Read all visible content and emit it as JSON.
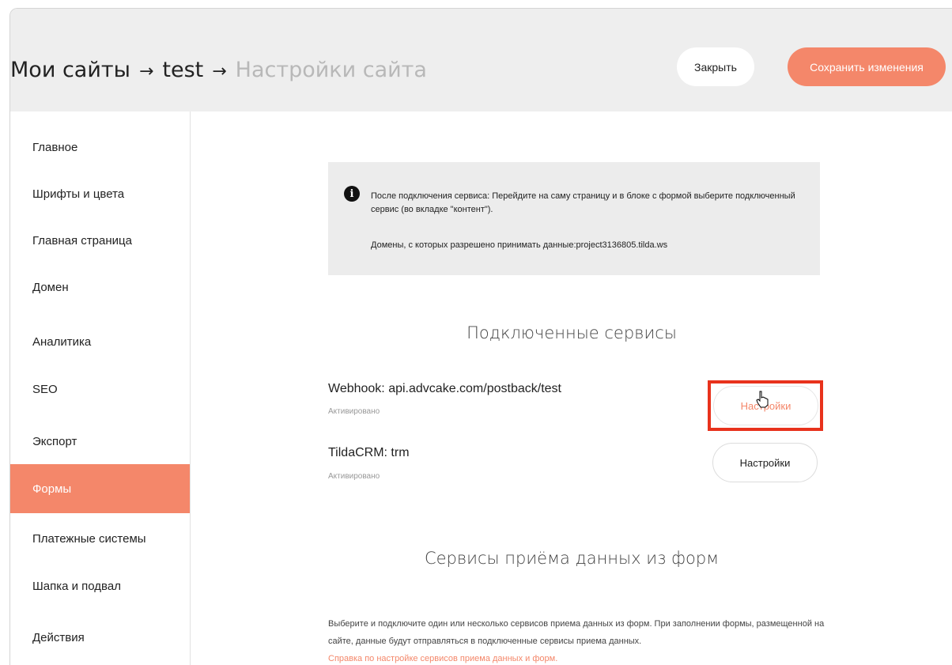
{
  "header": {
    "breadcrumb": [
      "Мои сайты",
      "test",
      "Настройки сайта"
    ],
    "arrow": "→",
    "close_label": "Закрыть",
    "save_label": "Сохранить изменения"
  },
  "sidebar": {
    "items": [
      {
        "label": "Главное"
      },
      {
        "label": "Шрифты и цвета"
      },
      {
        "label": "Главная страница"
      },
      {
        "label": "Домен"
      },
      {
        "label": "Аналитика"
      },
      {
        "label": "SEO"
      },
      {
        "label": "Экспорт"
      },
      {
        "label": "Формы",
        "active": true
      },
      {
        "label": "Платежные системы"
      },
      {
        "label": "Шапка и подвал"
      },
      {
        "label": "Действия"
      }
    ]
  },
  "info": {
    "icon": "info-icon",
    "icon_glyph": "i",
    "text": "После подключения сервиса: Перейдите на саму страницу и в блоке с формой выберите подключенный сервис (во вкладке \"контент\").",
    "domains": "Домены, с которых разрешено принимать данные:project3136805.tilda.ws"
  },
  "connected": {
    "title": "Подключенные сервисы",
    "services": [
      {
        "name": "Webhook: api.advcake.com/postback/test",
        "status": "Активировано",
        "button": "Настройки"
      },
      {
        "name": "TildaCRM: trm",
        "status": "Активировано",
        "button": "Настройки"
      }
    ]
  },
  "receivers": {
    "title": "Сервисы приёма данных из форм",
    "description": "Выберите и подключите один или несколько сервисов приема данных из форм. При заполнении формы, размещенной на сайте, данные будут отправляться в подключенные сервисы приема данных.",
    "help_link": "Справка по настройке сервисов приема данных и форм."
  },
  "colors": {
    "accent": "#f4876a",
    "highlight": "#e8321c",
    "header_bg": "#eeeeee",
    "info_bg": "#ececec"
  }
}
